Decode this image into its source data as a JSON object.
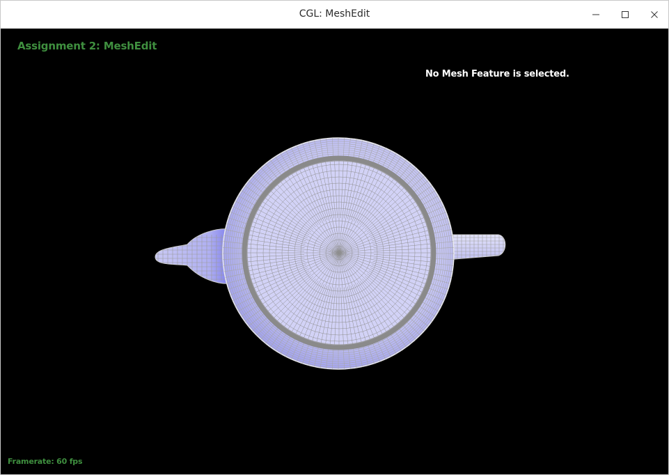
{
  "window": {
    "title": "CGL: MeshEdit",
    "controls": {
      "minimize_icon": "minimize-icon",
      "maximize_icon": "maximize-icon",
      "close_icon": "close-icon"
    }
  },
  "viewport": {
    "app_title": "Assignment 2: MeshEdit",
    "status": "No Mesh Feature is selected.",
    "framerate_label": "Framerate: 60 fps",
    "colors": {
      "background": "#000000",
      "text_green": "#3f8f3f",
      "text_white": "#ffffff",
      "mesh_fill": "#c8c8f4",
      "mesh_shade": "#8c8cf0",
      "wire": "#bdbdbd"
    }
  }
}
